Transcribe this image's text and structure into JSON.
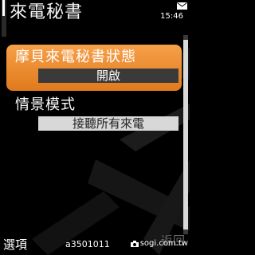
{
  "header": {
    "title": "來電秘書",
    "time": "15:46"
  },
  "settings": [
    {
      "label": "摩貝來電秘書狀態",
      "value": "開啟",
      "selected": true
    },
    {
      "label": "情景模式",
      "value": "接聽所有來電",
      "selected": false
    }
  ],
  "softkeys": {
    "left": "選項",
    "middle": "a3501011",
    "right": "返回"
  },
  "watermark": "sogi.com.tw",
  "colors": {
    "highlight": "#e98a2c",
    "background": "#000000"
  },
  "icons": [
    "signal-icon",
    "mail-icon",
    "camera-icon"
  ]
}
